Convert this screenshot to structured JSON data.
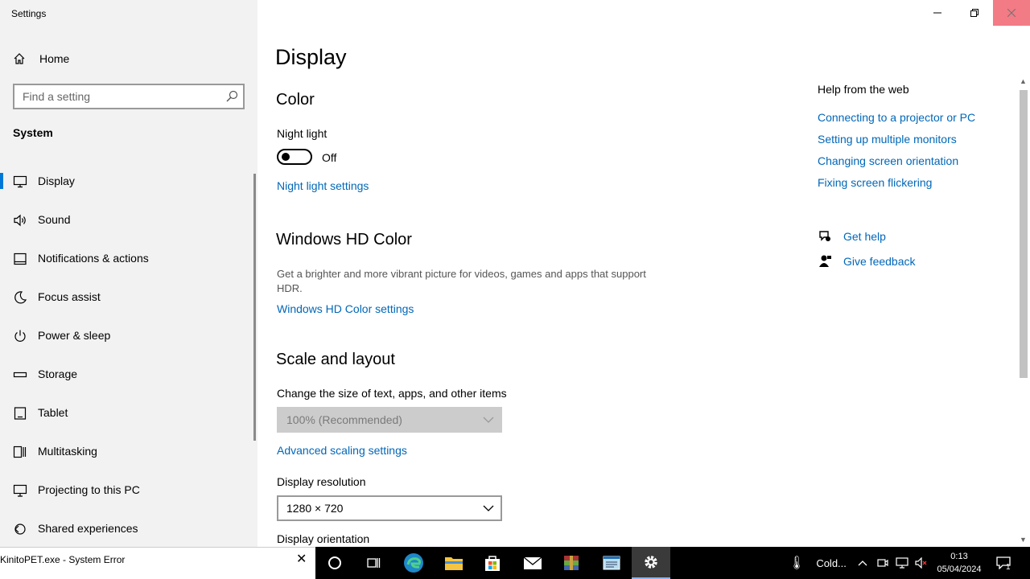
{
  "window": {
    "title": "Settings"
  },
  "sidebar": {
    "home": "Home",
    "search_placeholder": "Find a setting",
    "section": "System",
    "items": [
      {
        "label": "Display",
        "icon": "monitor-icon"
      },
      {
        "label": "Sound",
        "icon": "speaker-icon"
      },
      {
        "label": "Notifications & actions",
        "icon": "notification-icon"
      },
      {
        "label": "Focus assist",
        "icon": "moon-icon"
      },
      {
        "label": "Power & sleep",
        "icon": "power-icon"
      },
      {
        "label": "Storage",
        "icon": "storage-icon"
      },
      {
        "label": "Tablet",
        "icon": "tablet-icon"
      },
      {
        "label": "Multitasking",
        "icon": "multitasking-icon"
      },
      {
        "label": "Projecting to this PC",
        "icon": "projecting-icon"
      },
      {
        "label": "Shared experiences",
        "icon": "shared-icon"
      }
    ]
  },
  "main": {
    "title": "Display",
    "color": {
      "heading": "Color",
      "night_light_label": "Night light",
      "night_light_state": "Off",
      "night_light_link": "Night light settings"
    },
    "hdr": {
      "heading": "Windows HD Color",
      "description": "Get a brighter and more vibrant picture for videos, games and apps that support HDR.",
      "link": "Windows HD Color settings"
    },
    "scale": {
      "heading": "Scale and layout",
      "size_label": "Change the size of text, apps, and other items",
      "size_value": "100% (Recommended)",
      "advanced_link": "Advanced scaling settings",
      "resolution_label": "Display resolution",
      "resolution_value": "1280 × 720",
      "orientation_label": "Display orientation"
    },
    "help": {
      "title": "Help from the web",
      "links": [
        "Connecting to a projector or PC",
        "Setting up multiple monitors",
        "Changing screen orientation",
        "Fixing screen flickering"
      ],
      "get_help": "Get help",
      "give_feedback": "Give feedback"
    }
  },
  "taskbar": {
    "error_window": "KinitoPET.exe - System Error",
    "weather": "Cold...",
    "time": "0:13",
    "date": "05/04/2024",
    "notifications": "1"
  },
  "colors": {
    "accent": "#0078d7",
    "link": "#0067b8"
  }
}
